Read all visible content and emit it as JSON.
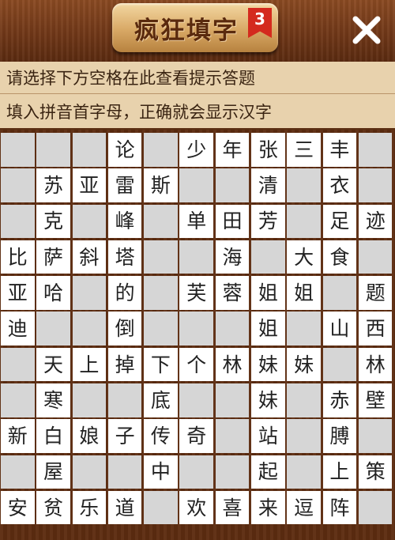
{
  "header": {
    "title": "疯狂填字",
    "level_badge": "3",
    "close_icon": "close-icon"
  },
  "hints": {
    "line1": "请选择下方空格在此查看提示答题",
    "line2": "填入拼音首字母，正确就会显示汉字"
  },
  "colors": {
    "wood_dark": "#5c2c10",
    "hint_bg": "#e8d2ad",
    "filled_cell": "#ffffff",
    "empty_cell": "#d6d6d6",
    "badge_red": "#d42a1e"
  },
  "grid": [
    [
      "",
      "",
      "",
      "论",
      "",
      "少",
      "年",
      "张",
      "三",
      "丰",
      ""
    ],
    [
      "",
      "苏",
      "亚",
      "雷",
      "斯",
      "",
      "",
      "清",
      "",
      "衣",
      ""
    ],
    [
      "",
      "克",
      "",
      "峰",
      "",
      "单",
      "田",
      "芳",
      "",
      "足",
      "迹"
    ],
    [
      "比",
      "萨",
      "斜",
      "塔",
      "",
      "",
      "海",
      "",
      "大",
      "食",
      ""
    ],
    [
      "亚",
      "哈",
      "",
      "的",
      "",
      "芙",
      "蓉",
      "姐",
      "姐",
      "",
      "题"
    ],
    [
      "迪",
      "",
      "",
      "倒",
      "",
      "",
      "",
      "姐",
      "",
      "山",
      "西"
    ],
    [
      "",
      "天",
      "上",
      "掉",
      "下",
      "个",
      "林",
      "妹",
      "妹",
      "",
      "林"
    ],
    [
      "",
      "寒",
      "",
      "",
      "底",
      "",
      "",
      "妹",
      "",
      "赤",
      "壁"
    ],
    [
      "新",
      "白",
      "娘",
      "子",
      "传",
      "奇",
      "",
      "站",
      "",
      "膊",
      ""
    ],
    [
      "",
      "屋",
      "",
      "",
      "中",
      "",
      "",
      "起",
      "",
      "上",
      "策"
    ],
    [
      "安",
      "贫",
      "乐",
      "道",
      "",
      "欢",
      "喜",
      "来",
      "逗",
      "阵",
      ""
    ]
  ]
}
